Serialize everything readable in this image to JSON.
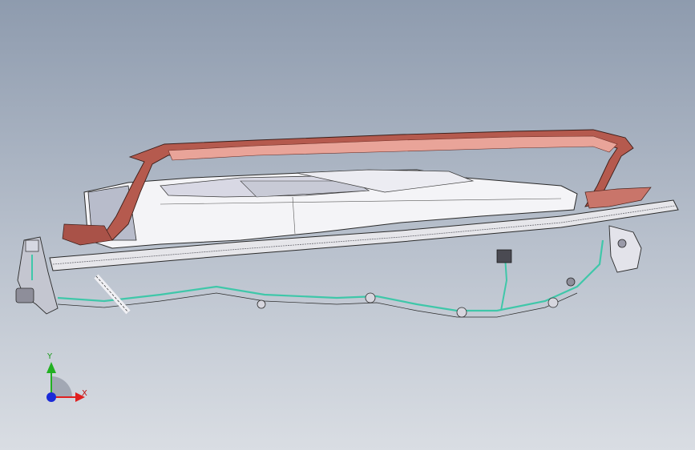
{
  "viewport": {
    "background_top": "#8e9bae",
    "background_bottom": "#d9dde3"
  },
  "triad": {
    "x_label": "X",
    "y_label": "Y",
    "x_color": "#e02020",
    "y_color": "#22b022",
    "z_color": "#1a2ad8"
  },
  "model": {
    "frame_color": "#b55a4e",
    "frame_highlight": "#e9a499",
    "body_color": "#f4f4f7",
    "body_shadow": "#c8cad6",
    "rail_color": "#e6e6ea",
    "harness_color": "#3fc7a9",
    "edge_color": "#2a2a2a"
  }
}
